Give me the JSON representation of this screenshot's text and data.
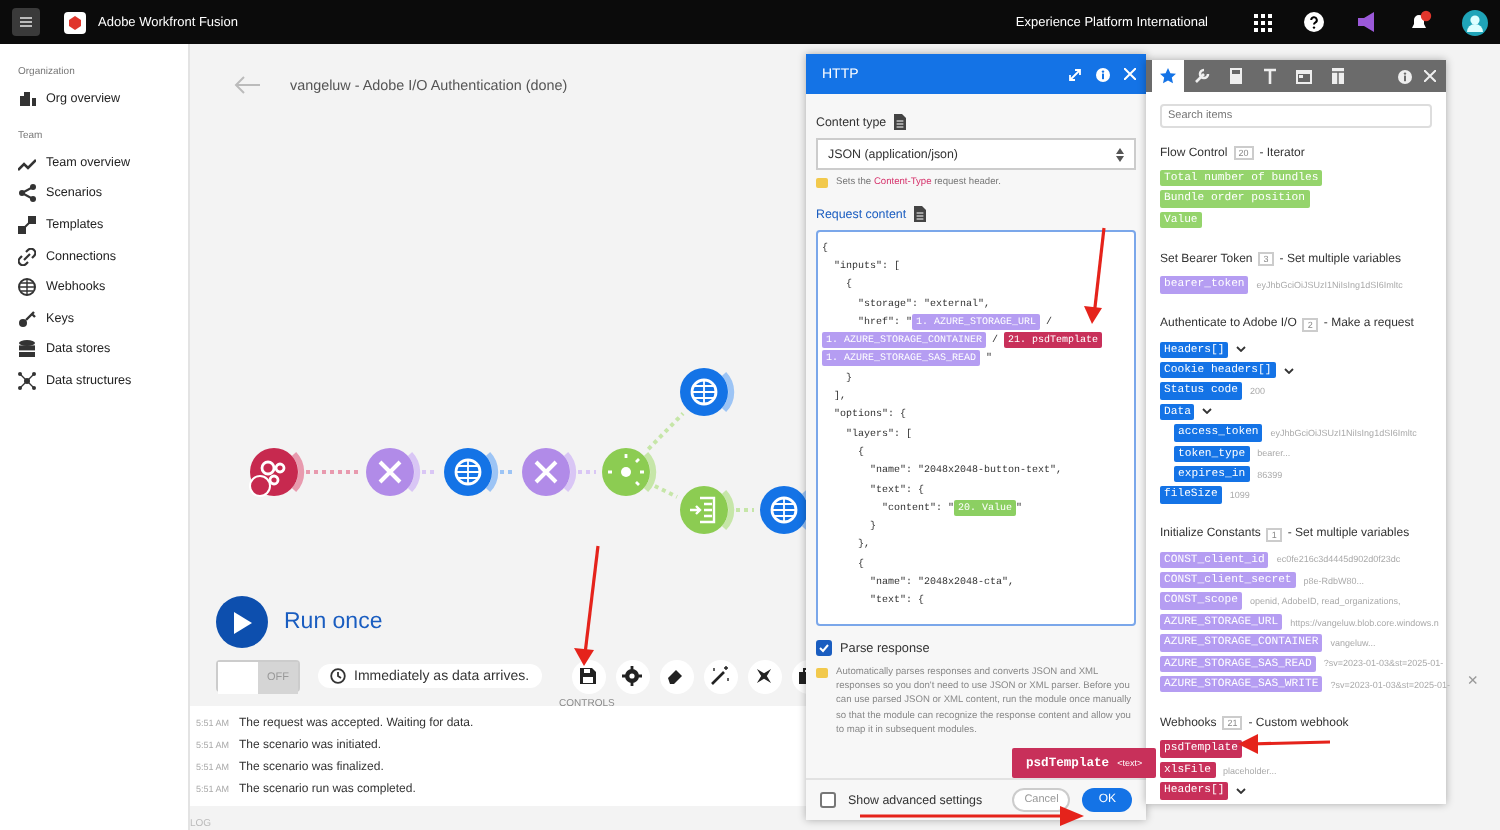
{
  "topbar": {
    "app_name": "Adobe Workfront Fusion",
    "org": "Experience Platform International"
  },
  "sidebar": {
    "sections": [
      {
        "heading": "Organization",
        "items": [
          "Org overview"
        ]
      },
      {
        "heading": "Team",
        "items": [
          "Team overview",
          "Scenarios",
          "Templates",
          "Connections",
          "Webhooks",
          "Keys",
          "Data stores",
          "Data structures"
        ]
      }
    ]
  },
  "scenario": {
    "title": "vangeluw - Adobe I/O Authentication (done)",
    "nodes": [
      {
        "kind": "webhook"
      },
      {
        "kind": "tools"
      },
      {
        "kind": "http"
      },
      {
        "kind": "tools"
      },
      {
        "kind": "router"
      },
      {
        "kind": "http"
      },
      {
        "kind": "iterator"
      },
      {
        "kind": "http"
      }
    ],
    "run_button": "Run once",
    "toggle": {
      "label": "OFF",
      "on": false
    },
    "schedule": "Immediately as data arrives.",
    "controls_label": "CONTROLS",
    "log": [
      {
        "time": "5:51 AM",
        "message": "The request was accepted. Waiting for data."
      },
      {
        "time": "5:51 AM",
        "message": "The scenario was initiated."
      },
      {
        "time": "5:51 AM",
        "message": "The scenario was finalized."
      },
      {
        "time": "5:51 AM",
        "message": "The scenario run was completed."
      }
    ],
    "log_label": "LOG",
    "close": "×"
  },
  "http_dialog": {
    "title": "HTTP",
    "content_type_label": "Content type",
    "content_type": "JSON (application/json)",
    "hint": {
      "before": "Sets the ",
      "code": "Content-Type",
      "after": " request header."
    },
    "request_content_label": "Request content",
    "request_lines": [
      [
        {
          "kind": "text",
          "text": "{"
        }
      ],
      [
        {
          "kind": "text",
          "text": "  \"inputs\": ["
        }
      ],
      [
        {
          "kind": "text",
          "text": "    {"
        }
      ],
      [
        {
          "kind": "text",
          "text": "      \"storage\": \"external\","
        }
      ],
      [
        {
          "kind": "text",
          "text": "      \"href\": \""
        },
        {
          "kind": "pill",
          "text": "1. AZURE_STORAGE_URL",
          "color": "#b59df2"
        },
        {
          "kind": "text",
          "text": " /"
        }
      ],
      [
        {
          "kind": "pill",
          "text": "1. AZURE_STORAGE_CONTAINER",
          "color": "#b59df2"
        },
        {
          "kind": "text",
          "text": " / "
        },
        {
          "kind": "pill",
          "text": "21. psdTemplate",
          "color": "#c8305a"
        }
      ],
      [
        {
          "kind": "pill",
          "text": "1. AZURE_STORAGE_SAS_READ",
          "color": "#b59df2"
        },
        {
          "kind": "text",
          "text": " \""
        }
      ],
      [
        {
          "kind": "text",
          "text": "    }"
        }
      ],
      [
        {
          "kind": "text",
          "text": "  ],"
        }
      ],
      [
        {
          "kind": "text",
          "text": "  \"options\": {"
        }
      ],
      [
        {
          "kind": "text",
          "text": "    \"layers\": ["
        }
      ],
      [
        {
          "kind": "text",
          "text": "      {"
        }
      ],
      [
        {
          "kind": "text",
          "text": "        \"name\": \"2048x2048-button-text\","
        }
      ],
      [
        {
          "kind": "text",
          "text": "        \"text\": {"
        }
      ],
      [
        {
          "kind": "text",
          "text": "          \"content\": \""
        },
        {
          "kind": "pill",
          "text": "20. Value",
          "color": "#8ccf62"
        },
        {
          "kind": "text",
          "text": "\""
        }
      ],
      [
        {
          "kind": "text",
          "text": "        }"
        }
      ],
      [
        {
          "kind": "text",
          "text": "      },"
        }
      ],
      [
        {
          "kind": "text",
          "text": "      {"
        }
      ],
      [
        {
          "kind": "text",
          "text": "        \"name\": \"2048x2048-cta\","
        }
      ],
      [
        {
          "kind": "text",
          "text": "        \"text\": {"
        }
      ]
    ],
    "parse_response": {
      "label": "Parse response",
      "checked": true
    },
    "parse_note": "Automatically parses responses and converts JSON and XML responses so you don't need to use JSON or XML parser. Before you can use parsed JSON or XML content, run the module once manually so that the module can recognize the response content and allow you to map it in subsequent modules.",
    "advanced": {
      "label": "Show advanced settings",
      "checked": false
    },
    "cancel": "Cancel",
    "ok": "OK"
  },
  "tooltip": {
    "name": "psdTemplate",
    "type": "<text>"
  },
  "mapping_panel": {
    "tabs": [
      {
        "selected": true
      },
      {
        "selected": false
      },
      {
        "selected": false
      },
      {
        "selected": false
      },
      {
        "selected": false
      },
      {
        "selected": false
      }
    ],
    "search": {
      "placeholder": "Search items"
    },
    "sections": [
      {
        "module": "Flow Control",
        "number": "20",
        "action": "- Iterator",
        "items": [
          {
            "label": "Total number of bundles",
            "color": "#95d46c"
          },
          {
            "label": "Bundle order position",
            "color": "#95d46c"
          },
          {
            "label": "Value",
            "color": "#95d46c"
          }
        ]
      },
      {
        "module": "Set Bearer Token",
        "number": "3",
        "action": "- Set multiple variables",
        "items": [
          {
            "label": "bearer_token",
            "color": "#b59df2",
            "value": "eyJhbGciOiJSUzI1NiIsIng1dSI6Imltc"
          }
        ]
      },
      {
        "module": "Authenticate to Adobe I/O",
        "number": "2",
        "action": "- Make a request",
        "items": [
          {
            "label": "Headers[]",
            "color": "#1473e6",
            "expandable": true
          },
          {
            "label": "Cookie headers[]",
            "color": "#1473e6",
            "expandable": true
          },
          {
            "label": "Status code",
            "color": "#1473e6",
            "value": "200"
          },
          {
            "label": "Data",
            "color": "#1473e6",
            "expandable": true,
            "children": [
              {
                "label": "access_token",
                "color": "#1473e6",
                "value": "eyJhbGciOiJSUzI1NiIsIng1dSI6Imltc"
              },
              {
                "label": "token_type",
                "color": "#1473e6",
                "value": "bearer..."
              },
              {
                "label": "expires_in",
                "color": "#1473e6",
                "value": "86399"
              }
            ]
          },
          {
            "label": "fileSize",
            "color": "#1473e6",
            "value": "1099"
          }
        ]
      },
      {
        "module": "Initialize Constants",
        "number": "1",
        "action": "- Set multiple variables",
        "items": [
          {
            "label": "CONST_client_id",
            "color": "#b59df2",
            "value": "ec0fe216c3d4445d902d0f23dc"
          },
          {
            "label": "CONST_client_secret",
            "color": "#b59df2",
            "value": "p8e-RdbW80..."
          },
          {
            "label": "CONST_scope",
            "color": "#b59df2",
            "value": "openid, AdobeID, read_organizations,"
          },
          {
            "label": "AZURE_STORAGE_URL",
            "color": "#b59df2",
            "value": "https://vangeluw.blob.core.windows.n"
          },
          {
            "label": "AZURE_STORAGE_CONTAINER",
            "color": "#b59df2",
            "value": "vangeluw..."
          },
          {
            "label": "AZURE_STORAGE_SAS_READ",
            "color": "#b59df2",
            "value": "?sv=2023-01-03&st=2025-01-"
          },
          {
            "label": "AZURE_STORAGE_SAS_WRITE",
            "color": "#b59df2",
            "value": "?sv=2023-01-03&st=2025-01-"
          }
        ]
      },
      {
        "module": "Webhooks",
        "number": "21",
        "action": "- Custom webhook",
        "items": [
          {
            "label": "psdTemplate",
            "color": "#c8305a"
          },
          {
            "label": "xlsFile",
            "color": "#c8305a",
            "value": "placeholder..."
          },
          {
            "label": "Headers[]",
            "color": "#c8305a",
            "expandable": true
          }
        ]
      }
    ]
  }
}
